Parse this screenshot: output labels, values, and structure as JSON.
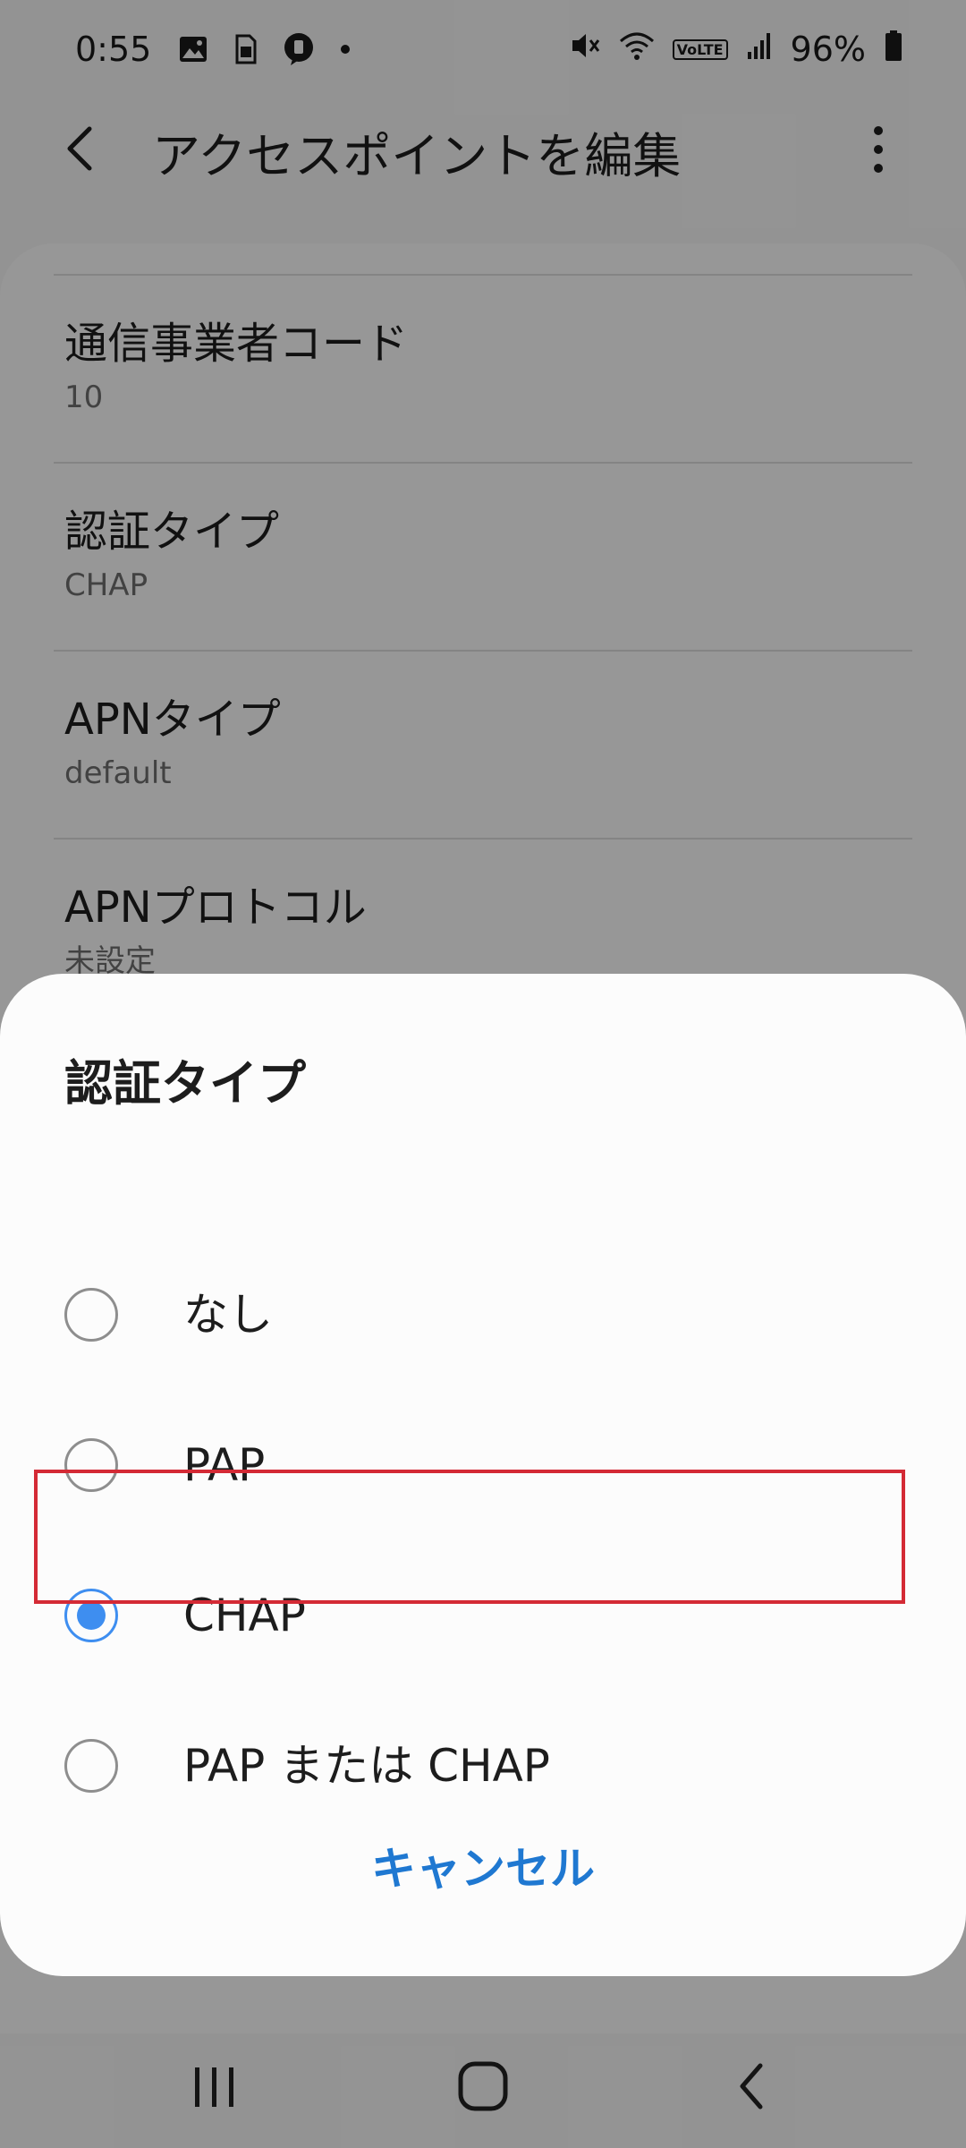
{
  "status_bar": {
    "time": "0:55",
    "battery": "96%",
    "volte": "VoLTE",
    "icons": [
      "image-icon",
      "sim-icon",
      "messenger-icon",
      "dot-icon",
      "mute-icon",
      "wifi-icon",
      "volte-icon",
      "signal-icon",
      "battery-icon"
    ]
  },
  "app_bar": {
    "title": "アクセスポイントを編集",
    "back_icon": "back-arrow-icon",
    "more_icon": "more-vertical-icon"
  },
  "settings": [
    {
      "label": "通信事業者コード",
      "value": "10"
    },
    {
      "label": "認証タイプ",
      "value": "CHAP"
    },
    {
      "label": "APNタイプ",
      "value": "default"
    },
    {
      "label": "APNプロトコル",
      "value": "未設定"
    }
  ],
  "dialog": {
    "title": "認証タイプ",
    "options": [
      {
        "label": "なし",
        "selected": false
      },
      {
        "label": "PAP",
        "selected": false
      },
      {
        "label": "CHAP",
        "selected": true
      },
      {
        "label": "PAP または CHAP",
        "selected": false
      }
    ],
    "cancel_label": "キャンセル",
    "accent_color": "#3e8ef0",
    "highlight_color": "#d42a35"
  },
  "nav_bar": {
    "icons": [
      "recent-apps-icon",
      "home-icon",
      "back-icon"
    ]
  }
}
